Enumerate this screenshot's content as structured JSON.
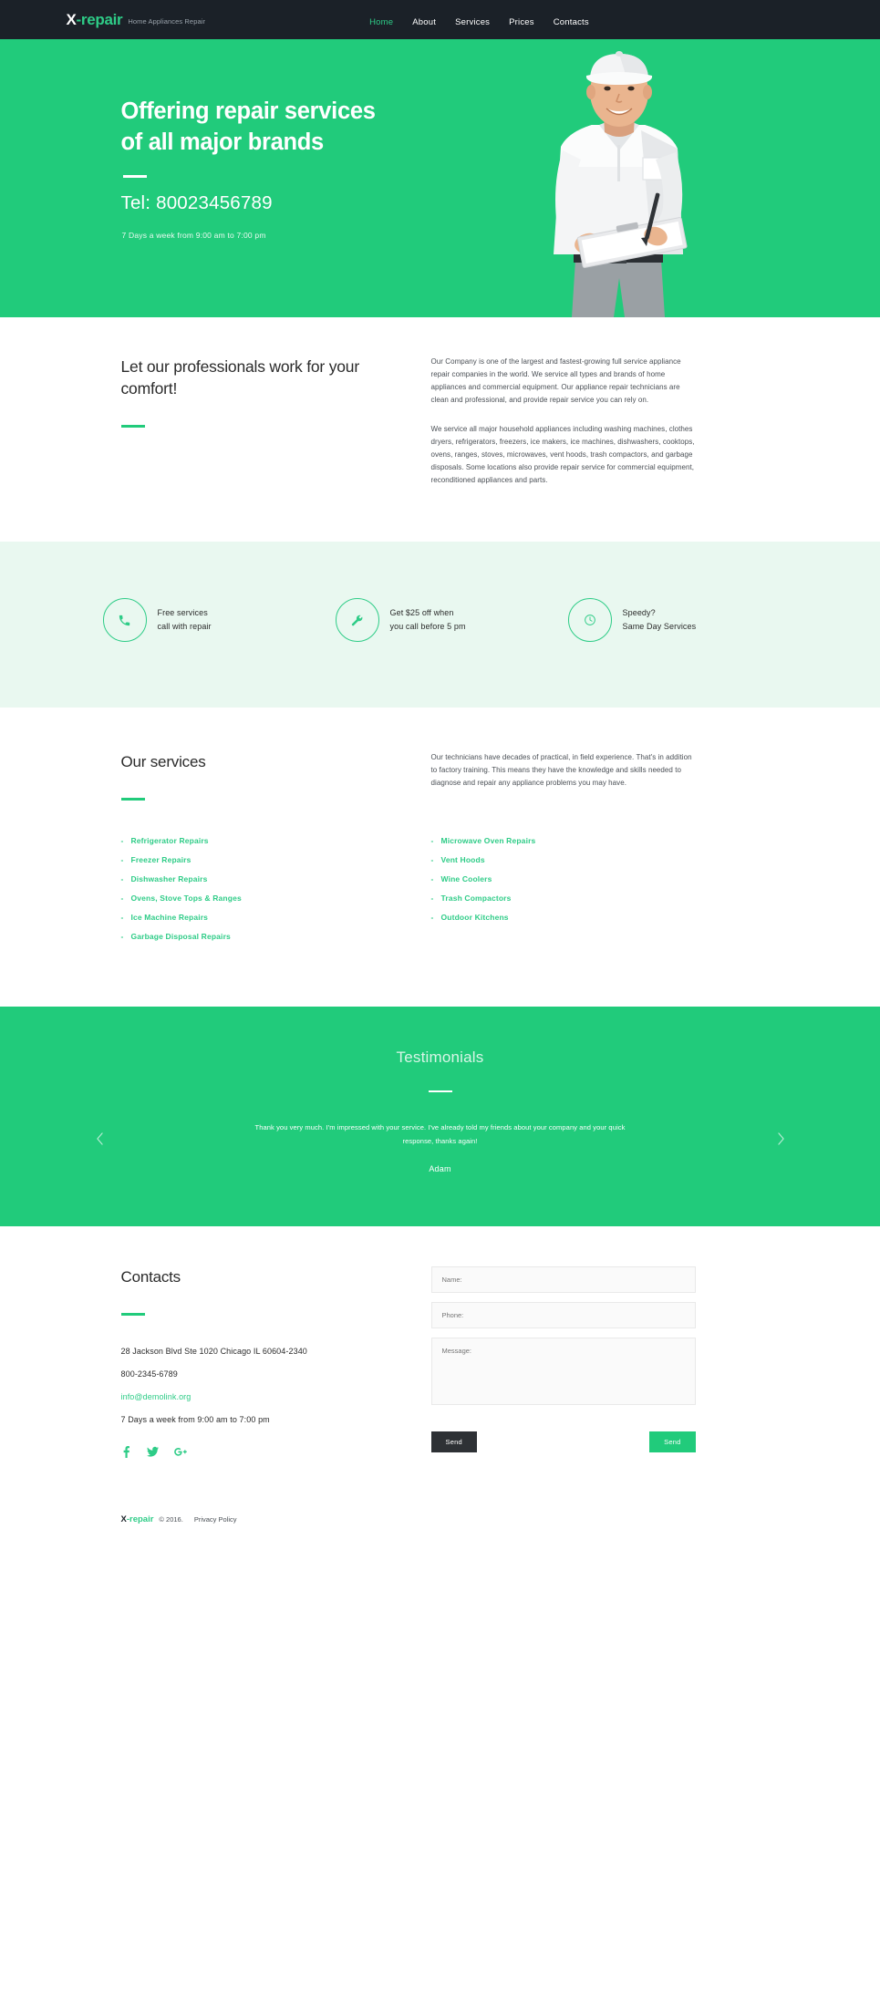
{
  "brand": {
    "logo_x": "X",
    "logo_rest": "-repair",
    "tagline": "Home Appliances Repair"
  },
  "nav": {
    "items": [
      {
        "label": "Home",
        "active": true
      },
      {
        "label": "About",
        "active": false
      },
      {
        "label": "Services",
        "active": false
      },
      {
        "label": "Prices",
        "active": false
      },
      {
        "label": "Contacts",
        "active": false
      }
    ]
  },
  "hero": {
    "title_line1": "Offering repair services",
    "title_line2": "of all major brands",
    "tel": "Tel: 80023456789",
    "hours": "7 Days a week from 9:00 am to 7:00 pm",
    "image_alt": "repair-technician-photo"
  },
  "about": {
    "heading": "Let our professionals work for your comfort!",
    "paragraph1": "Our Company is one of the largest and fastest-growing full service appliance repair companies in the world. We service all types and brands of home appliances and commercial equipment. Our appliance repair technicians are clean and professional, and provide repair service you can rely on.",
    "paragraph2": "We service all major household appliances including washing machines, clothes dryers, refrigerators, freezers, ice makers, ice machines, dishwashers, cooktops, ovens, ranges, stoves, microwaves, vent hoods, trash compactors, and garbage disposals. Some locations also provide repair service for commercial equipment, reconditioned appliances and parts."
  },
  "features": {
    "items": [
      {
        "icon": "phone-icon",
        "line1": "Free services",
        "line2": "call with repair"
      },
      {
        "icon": "wrench-icon",
        "line1": "Get $25 off when",
        "line2": "you call before 5 pm"
      },
      {
        "icon": "clock-icon",
        "line1": "Speedy?",
        "line2": "Same Day Services"
      }
    ]
  },
  "services": {
    "heading": "Our services",
    "intro": "Our technicians have decades of practical, in field experience. That's in addition to factory training. This means they have the knowledge and skills needed to diagnose and repair any appliance problems you may have.",
    "dash": "-",
    "column1": [
      "Refrigerator Repairs",
      "Freezer Repairs",
      "Dishwasher Repairs",
      "Ovens, Stove Tops & Ranges",
      "Ice Machine Repairs",
      "Garbage Disposal Repairs"
    ],
    "column2": [
      "Microwave Oven Repairs",
      "Vent Hoods",
      "Wine Coolers",
      "Trash Compactors",
      "Outdoor Kitchens"
    ]
  },
  "testimonials": {
    "title": "Testimonials",
    "quote": "Thank you very much. I'm impressed with your service. I've already told my friends about your company and your quick response, thanks again!",
    "author": "Adam",
    "prev_icon": "chevron-left-icon",
    "next_icon": "chevron-right-icon"
  },
  "contacts": {
    "heading": "Contacts",
    "address": "28 Jackson Blvd Ste 1020 Chicago IL 60604-2340",
    "phone": "800-2345-6789",
    "email": "info@demolink.org",
    "hours": "7 Days a week from 9:00 am to 7:00 pm",
    "socials": [
      {
        "name": "facebook-icon",
        "glyph": "f"
      },
      {
        "name": "twitter-icon",
        "glyph": "t"
      },
      {
        "name": "google-plus-icon",
        "glyph": "g+"
      }
    ],
    "form": {
      "name_placeholder": "Name:",
      "phone_placeholder": "Phone:",
      "message_placeholder": "Message:",
      "send_dark_label": "Send",
      "send_green_label": "Send"
    }
  },
  "footer": {
    "logo_x": "X",
    "logo_rest": "-repair",
    "copyright": "© 2016.",
    "privacy": "Privacy Policy"
  },
  "colors": {
    "brand_green": "#21cb7b",
    "accent_green": "#2ecc87",
    "header_dark": "#1b2128",
    "mint_bg": "#e9f8f0",
    "button_dark": "#2e3135"
  }
}
